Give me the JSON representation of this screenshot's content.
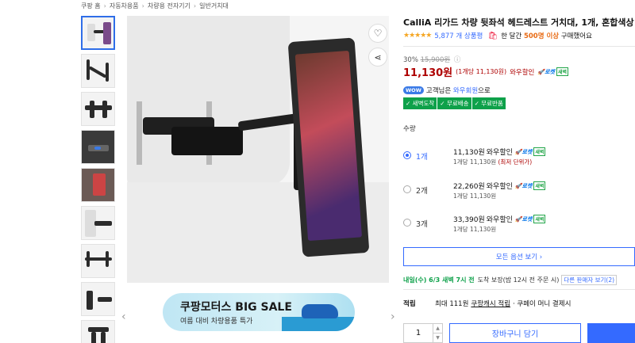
{
  "breadcrumb": [
    "쿠팡 홈",
    "자동차용품",
    "차량용 전자기기",
    "일반거치대"
  ],
  "product": {
    "title": "CalliA 리가드 차량 뒷좌석 헤드레스트 거치대, 1개, 혼합색상",
    "stars": "★★★★★",
    "reviews": "5,877 개 상품평",
    "bought_prefix": "한 달간",
    "bought_count": "500명 이상",
    "bought_suffix": "구매했어요"
  },
  "pricing": {
    "discount_rate": "30%",
    "original_price": "15,900원",
    "price": "11,130원",
    "unit_price": "(1개당 11,130원)",
    "wow_label": "와우할인",
    "rocket_label": "로켓",
    "rocket_new": "새벽"
  },
  "wow": {
    "badge": "WOW",
    "text_prefix": "고객님은",
    "text_link": "와우회원",
    "text_suffix": "으로",
    "benefits": [
      "✓ 새벽도착",
      "✓ 무료배송",
      "✓ 무료반품"
    ]
  },
  "quantity_label": "수량",
  "options": [
    {
      "count": "1개",
      "price": "11,130원",
      "wow": "와우할인",
      "unit": "1개당 11,130원",
      "note": "(최저 단위가)",
      "selected": true
    },
    {
      "count": "2개",
      "price": "22,260원",
      "wow": "와우할인",
      "unit": "1개당 11,130원",
      "note": "",
      "selected": false
    },
    {
      "count": "3개",
      "price": "33,390원",
      "wow": "와우할인",
      "unit": "1개당 11,130원",
      "note": "",
      "selected": false
    }
  ],
  "all_options_button": "모든 옵션 보기 ›",
  "delivery": {
    "date": "내일(수) 6/3 새벽 7시 전",
    "text": "도착 보장(밤 12시 전 주문 시)",
    "other_sellers": "다른 판매자 보기(2)"
  },
  "points": {
    "label": "적립",
    "text_prefix": "최대 111원",
    "link": "쿠팡캐시 적립",
    "text_suffix": "· 쿠페이 머니 결제시"
  },
  "quantity": "1",
  "cart_button": "장바구니 담기",
  "banner": {
    "title": "쿠팡모터스 BIG SALE",
    "subtitle": "여름 대비 차량용품 특가"
  },
  "colors": {
    "accent": "#346aff",
    "price": "#ae0000",
    "benefit_green": "#0ea14a"
  }
}
